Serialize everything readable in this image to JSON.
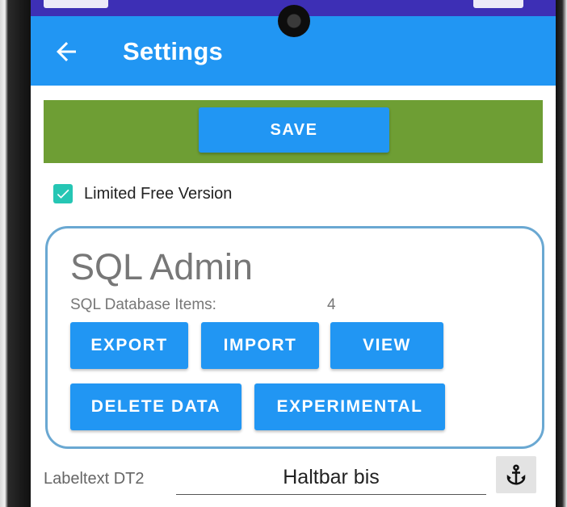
{
  "appbar": {
    "title": "Settings",
    "back_icon": "arrow-left-icon"
  },
  "save": {
    "label": "SAVE"
  },
  "options": {
    "limited_free_version_label": "Limited Free Version",
    "limited_free_version_checked": true
  },
  "sql_admin": {
    "title": "SQL Admin",
    "items_label": "SQL Database Items:",
    "items_count": "4",
    "buttons": {
      "export": "EXPORT",
      "import": "IMPORT",
      "view": "VIEW",
      "delete_data": "DELETE DATA",
      "experimental": "EXPERIMENTAL"
    }
  },
  "label_dt2": {
    "label": "Labeltext DT2",
    "value": "Haltbar bis",
    "action_icon": "anchor-icon"
  },
  "colors": {
    "appbar": "#2196f3",
    "status_bar": "#3d2fb5",
    "save_panel": "#6e9e34",
    "button": "#2196f3",
    "checkbox": "#26c6b4",
    "card_border": "#6aa8d2"
  }
}
